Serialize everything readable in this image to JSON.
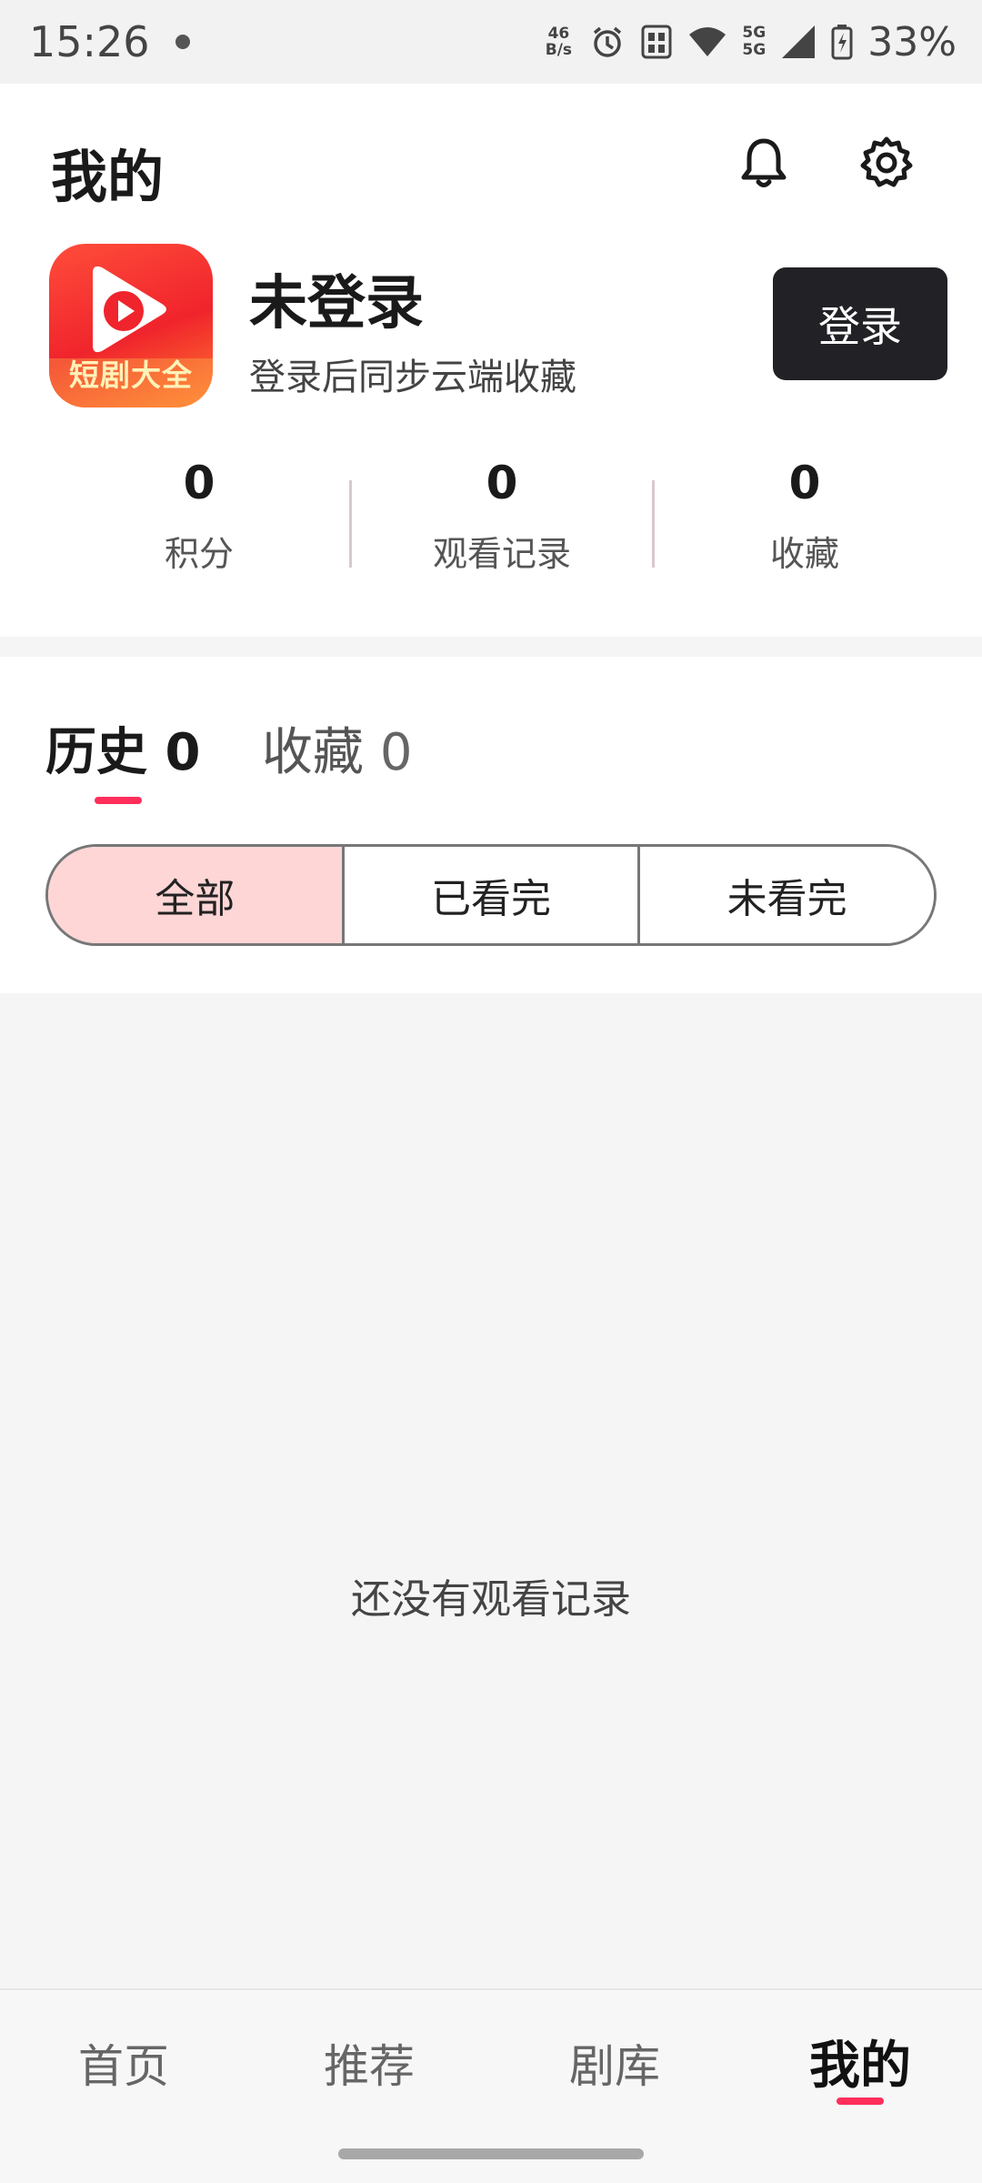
{
  "status_bar": {
    "time": "15:26",
    "net_speed_value": "46",
    "net_speed_unit": "B/s",
    "signal_label_top": "5G",
    "signal_label_bottom": "5G",
    "battery": "33%"
  },
  "header": {
    "title": "我的",
    "icons": [
      "bell-icon",
      "gear-icon"
    ]
  },
  "profile": {
    "app_logo_text": "短剧大全",
    "name": "未登录",
    "subtitle": "登录后同步云端收藏",
    "login_label": "登录"
  },
  "stats": [
    {
      "value": "0",
      "label": "积分"
    },
    {
      "value": "0",
      "label": "观看记录"
    },
    {
      "value": "0",
      "label": "收藏"
    }
  ],
  "tabs": [
    {
      "label": "历史",
      "count": "0",
      "active": true
    },
    {
      "label": "收藏",
      "count": "0",
      "active": false
    }
  ],
  "filters": [
    {
      "label": "全部",
      "active": true
    },
    {
      "label": "已看完",
      "active": false
    },
    {
      "label": "未看完",
      "active": false
    }
  ],
  "empty_message": "还没有观看记录",
  "bottom_nav": [
    {
      "label": "首页"
    },
    {
      "label": "推荐"
    },
    {
      "label": "剧库"
    },
    {
      "label": "我的",
      "active": true
    }
  ],
  "colors": {
    "accent": "#ff2e5b",
    "login_button": "#212126",
    "active_filter": "#ffd6d6",
    "logo_red": "#f0242c"
  }
}
